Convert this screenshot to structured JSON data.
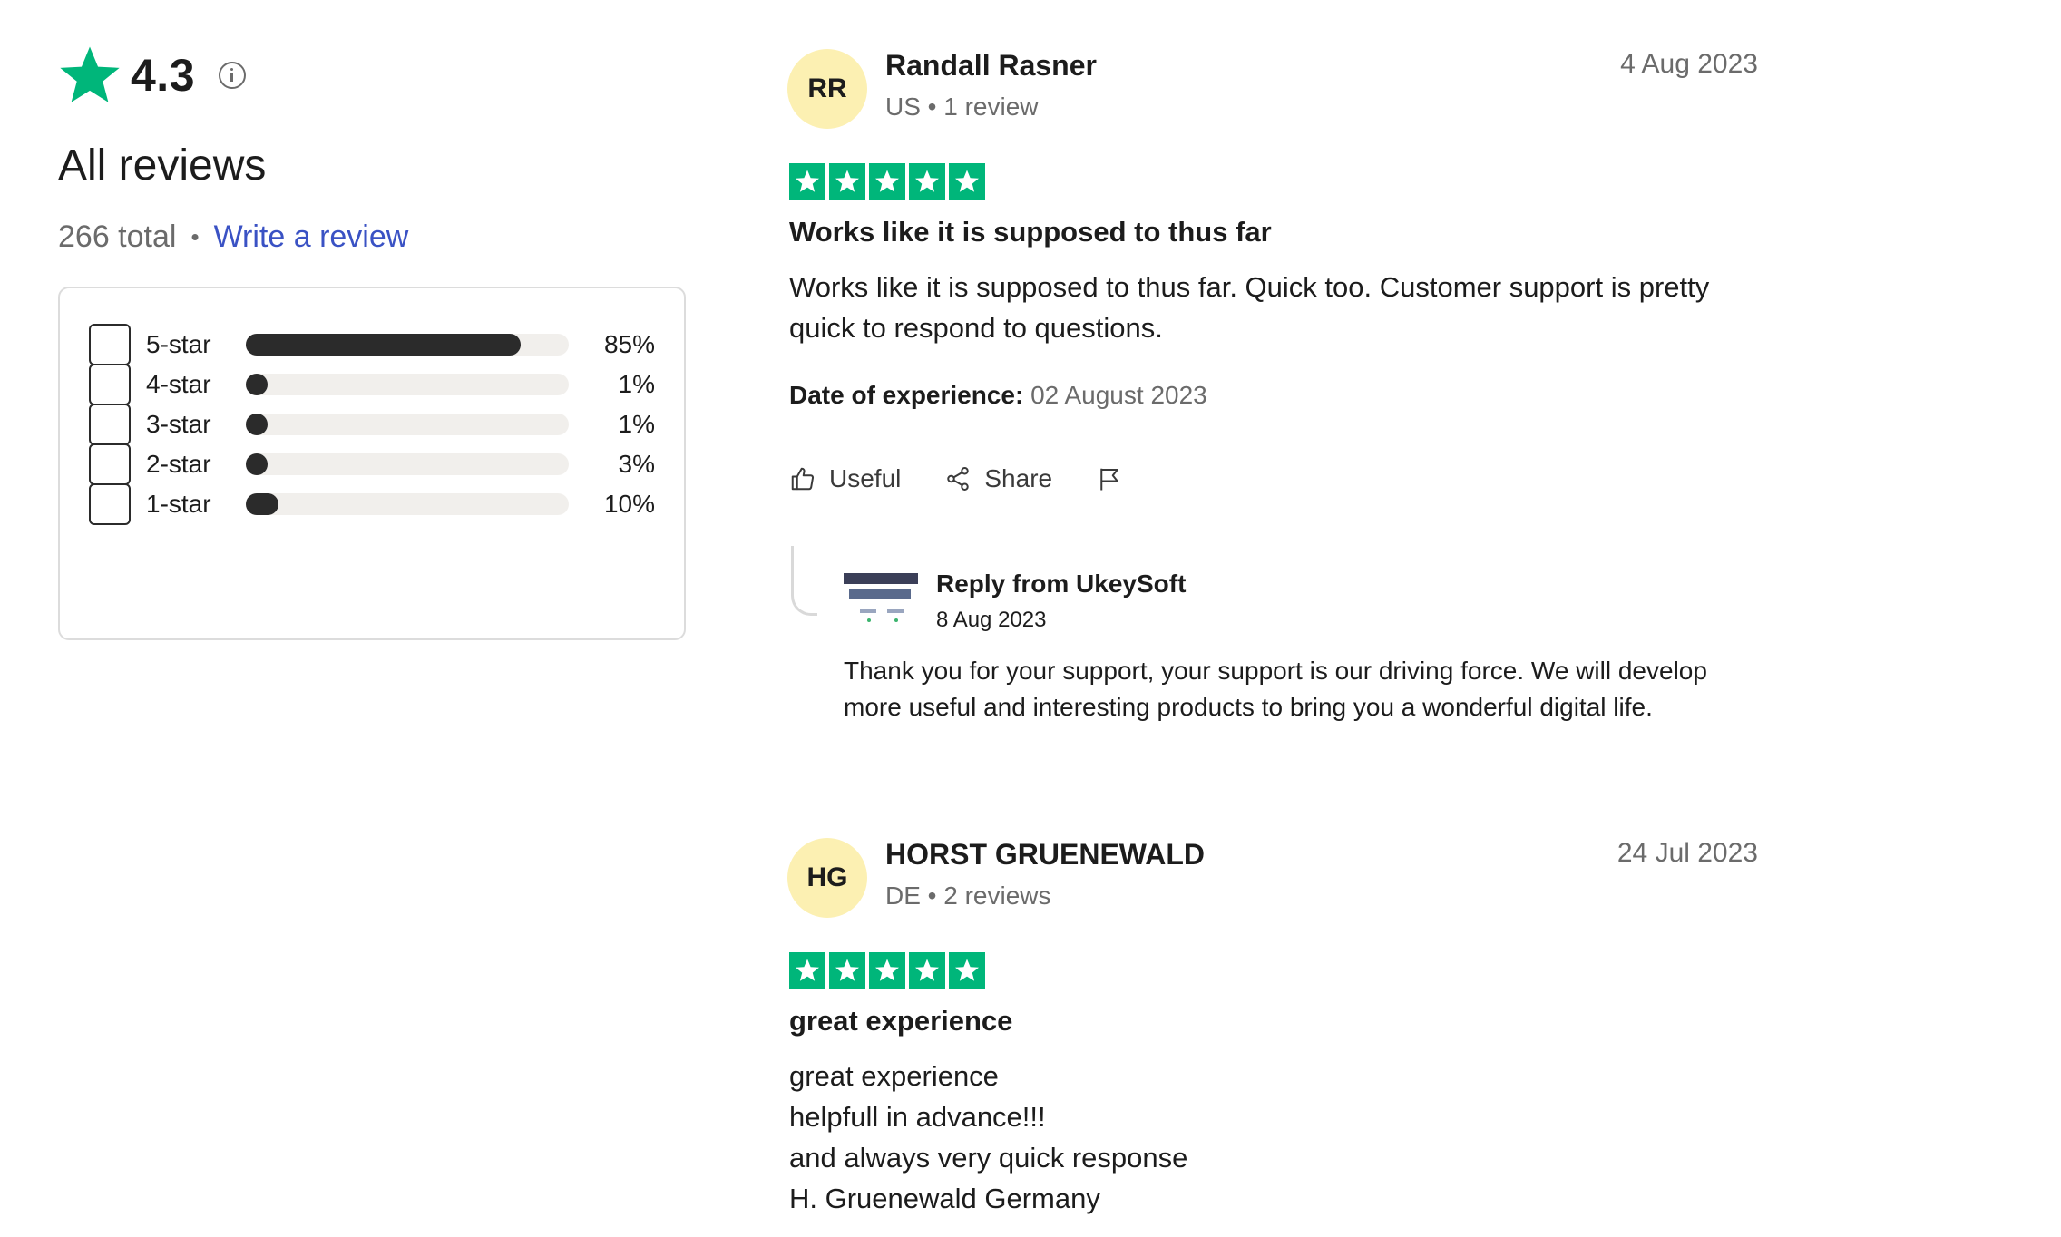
{
  "summary": {
    "rating": "4.3",
    "heading": "All reviews",
    "total": "266 total",
    "separator": "•",
    "write_review": "Write a review",
    "filters": [
      {
        "label": "5-star",
        "percent": "85%",
        "fill": 0.85
      },
      {
        "label": "4-star",
        "percent": "1%",
        "fill": 0.01
      },
      {
        "label": "3-star",
        "percent": "1%",
        "fill": 0.01
      },
      {
        "label": "2-star",
        "percent": "3%",
        "fill": 0.03
      },
      {
        "label": "1-star",
        "percent": "10%",
        "fill": 0.1
      }
    ]
  },
  "colors": {
    "star_green": "#00b67a",
    "avatar_bg": "#fcf0b2",
    "link_blue": "#3a52c4",
    "bar_fill": "#2b2b2b",
    "bar_track": "#f1efec"
  },
  "reviews": [
    {
      "initials": "RR",
      "name": "Randall Rasner",
      "meta": "US • 1 review",
      "date": "4 Aug 2023",
      "stars": 5,
      "title": "Works like it is supposed to thus far",
      "body": "Works like it is supposed to thus far. Quick too. Customer support is pretty quick to respond to questions.",
      "experience_label": "Date of experience:",
      "experience_date": "02 August 2023",
      "actions": {
        "useful": "Useful",
        "share": "Share"
      },
      "icons": [
        "thumbs-up-icon",
        "share-icon",
        "flag-icon"
      ],
      "reply": {
        "from": "Reply from UkeySoft",
        "date": "8 Aug 2023",
        "body": "Thank you for your support, your support is our driving force. We will develop more useful and interesting products to bring you a wonderful digital life."
      }
    },
    {
      "initials": "HG",
      "name": "HORST GRUENEWALD",
      "meta": "DE • 2 reviews",
      "date": "24 Jul 2023",
      "stars": 5,
      "title": "great experience",
      "body": "great experience\nhelpfull in advance!!!\nand always very quick response\nH. Gruenewald Germany"
    }
  ]
}
